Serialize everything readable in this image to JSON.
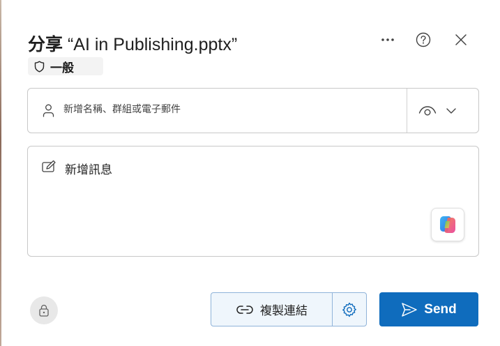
{
  "dialog": {
    "title_prefix": "分享",
    "title_file": "“AI in Publishing.pptx”"
  },
  "header_actions": {
    "more_icon": "more-horizontal-icon",
    "help_icon": "question-circle-icon",
    "close_icon": "dismiss-icon"
  },
  "sensitivity": {
    "label": "一般",
    "icon": "shield-icon"
  },
  "people_picker": {
    "placeholder": "新增名稱、群組或電子郵件",
    "value": "",
    "permission_icon": "eye-icon",
    "dropdown_icon": "chevron-down-icon"
  },
  "message": {
    "placeholder": "新增訊息",
    "value": "",
    "copilot_icon": "copilot-icon"
  },
  "footer": {
    "lock_icon": "lock-icon",
    "copy_link_label": "複製連結",
    "copy_link_icon": "link-icon",
    "link_settings_icon": "gear-icon",
    "send_label": "Send",
    "send_icon": "send-icon"
  },
  "colors": {
    "primary": "#0f6cbd",
    "copy_link_bg": "#eff6fc",
    "copy_link_border": "#8fb3d9"
  }
}
